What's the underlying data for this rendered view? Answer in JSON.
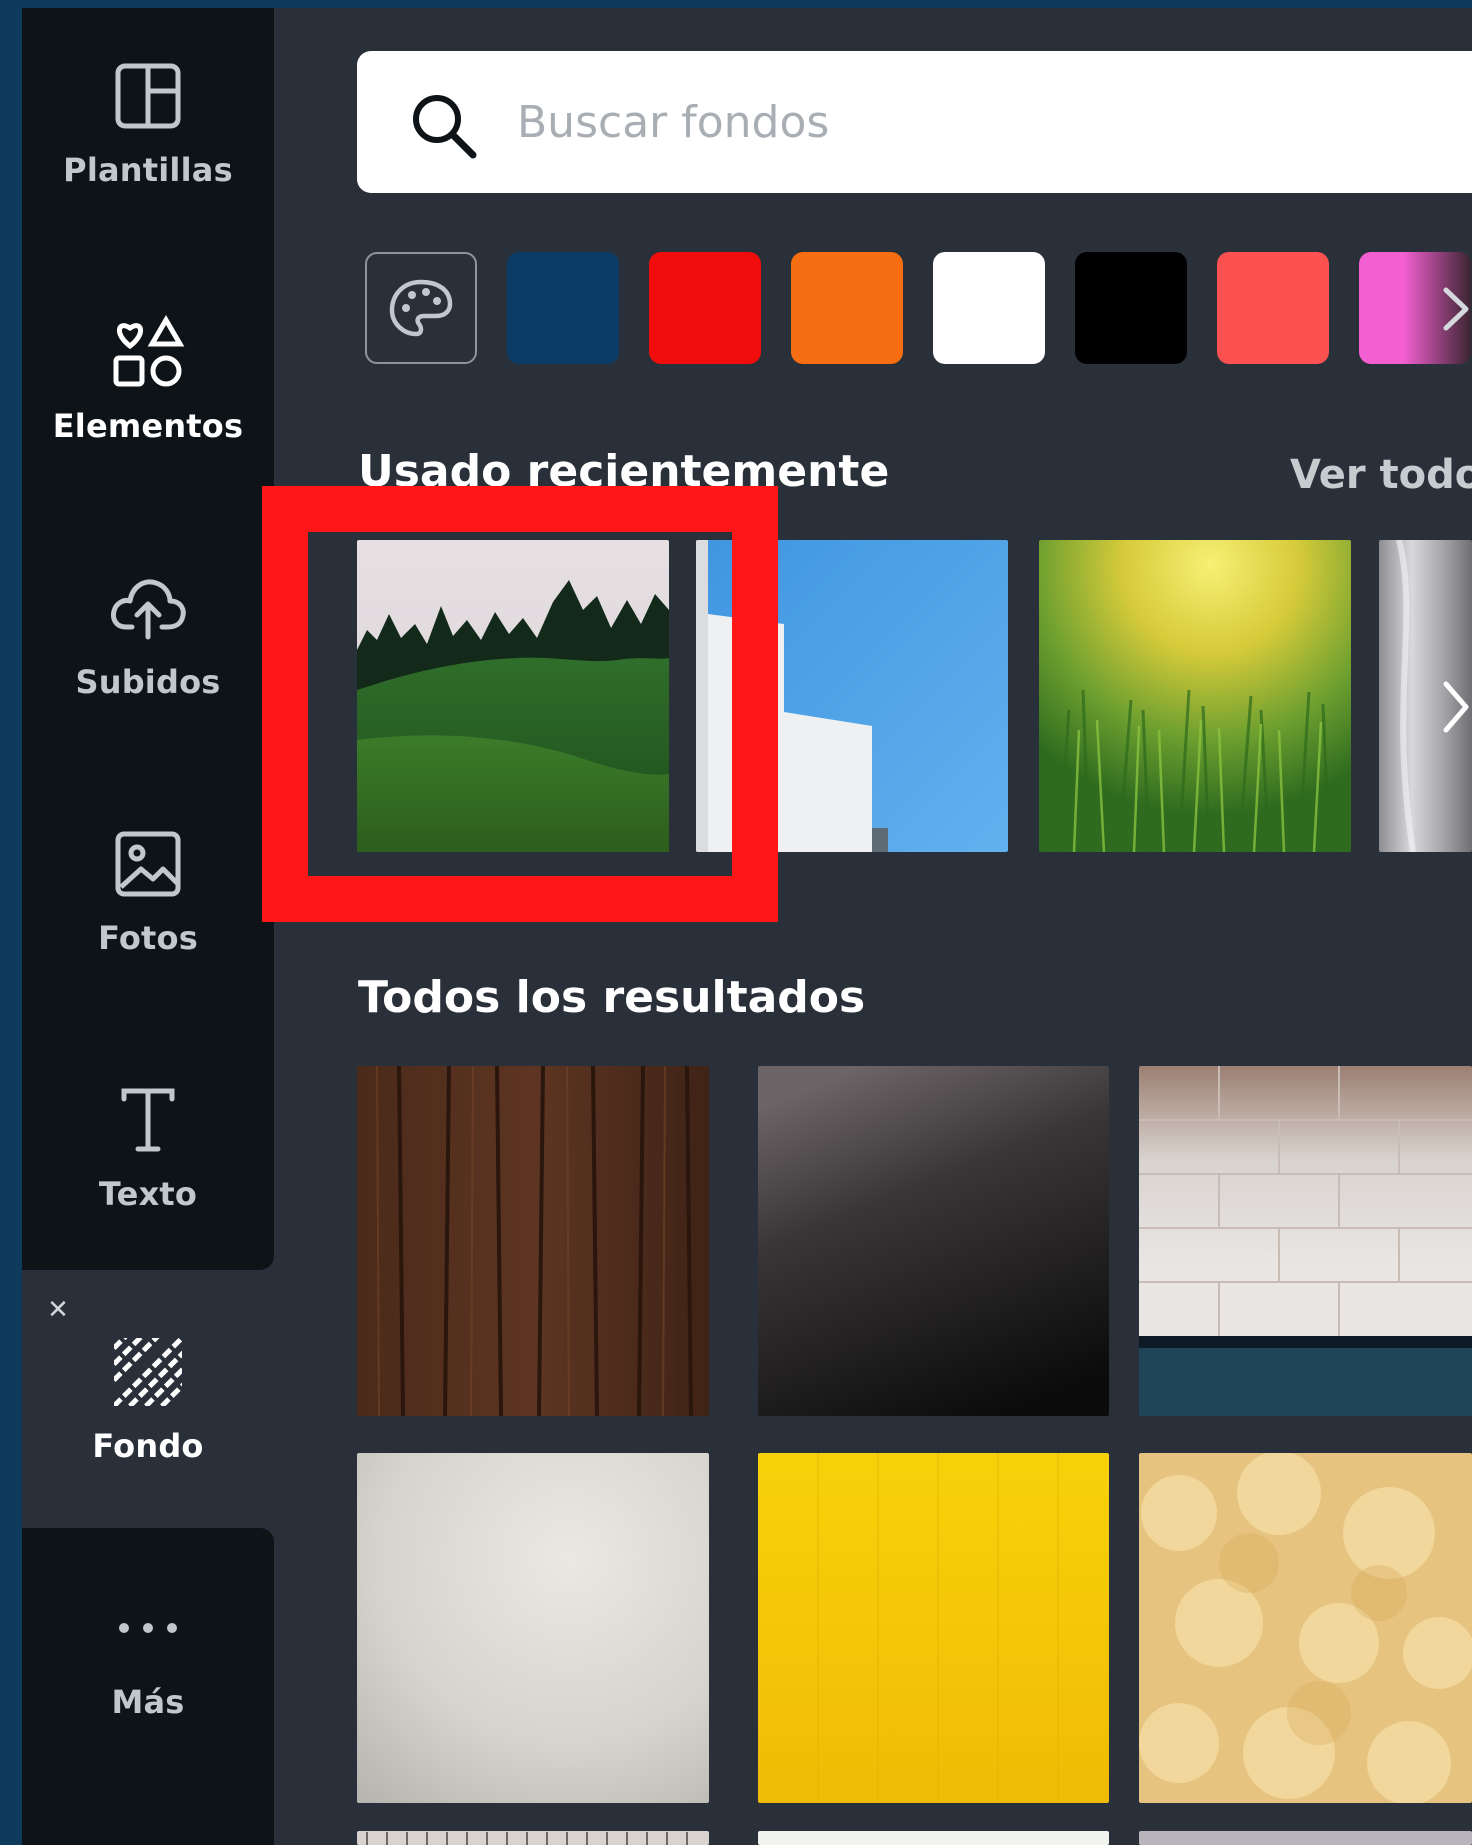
{
  "sidebar": {
    "items": [
      {
        "label": "Plantillas",
        "icon": "templates-icon"
      },
      {
        "label": "Elementos",
        "icon": "elements-icon"
      },
      {
        "label": "Subidos",
        "icon": "upload-cloud-icon"
      },
      {
        "label": "Fotos",
        "icon": "photos-icon"
      },
      {
        "label": "Texto",
        "icon": "text-icon"
      },
      {
        "label": "Fondo",
        "icon": "background-pattern-icon"
      },
      {
        "label": "Más",
        "icon": "more-dots-icon"
      }
    ],
    "active": "Fondo",
    "close_icon": "close-icon"
  },
  "search": {
    "placeholder": "Buscar fondos",
    "value": ""
  },
  "swatches": {
    "palette_icon": "palette-icon",
    "colors": [
      "#0b3c68",
      "#f20d0d",
      "#f66d12",
      "#ffffff",
      "#000000",
      "#fb5150",
      "#f35fd0"
    ],
    "next_icon": "chevron-right-icon"
  },
  "recent": {
    "title": "Usado recientemente",
    "see_all": "Ver todo",
    "items": [
      "green-hills-forest",
      "white-building-blue-sky",
      "green-grass-yellow-light",
      "gray-abstract"
    ],
    "next_icon": "chevron-right-icon"
  },
  "results": {
    "title": "Todos los resultados",
    "items": [
      "dark-wood",
      "gray-black-gradient",
      "white-brick-wall",
      "light-gray-concrete",
      "yellow-surface",
      "gold-bokeh"
    ]
  },
  "highlight_color": "#ff1616"
}
